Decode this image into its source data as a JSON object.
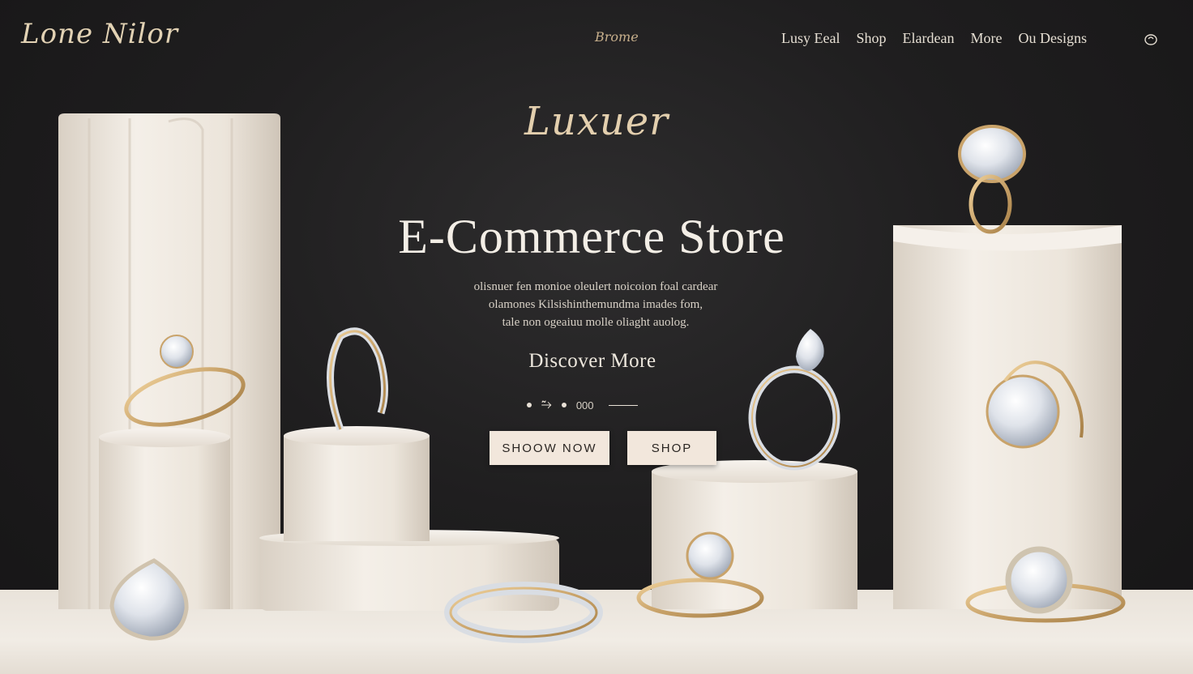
{
  "header": {
    "logo": "Lone Nilor",
    "center_mark": "Brome",
    "nav": [
      "Lusy Eeal",
      "Shop",
      "Elardean",
      "More",
      "Ou Designs"
    ],
    "cart_icon": "shopping-bag-icon"
  },
  "hero": {
    "script_title": "Luxuer",
    "title": "E-Commerce Store",
    "body_lines": [
      "olisnuer fen monioe oleulert noicoion foal cardear",
      "olamones Kilsishinthemundma imades fom,",
      "tale non ogeaiuu molle oliaght auolog."
    ],
    "discover_label": "Discover More",
    "carousel": {
      "ornament": "⥲",
      "counter": "000"
    },
    "buttons": {
      "primary": "SHOOW NOW",
      "secondary": "SHOP"
    }
  },
  "colors": {
    "background": "#1f1e1f",
    "gold": "#c9a36a",
    "cream": "#f2e7dc",
    "pedestal": "#eee7de"
  }
}
